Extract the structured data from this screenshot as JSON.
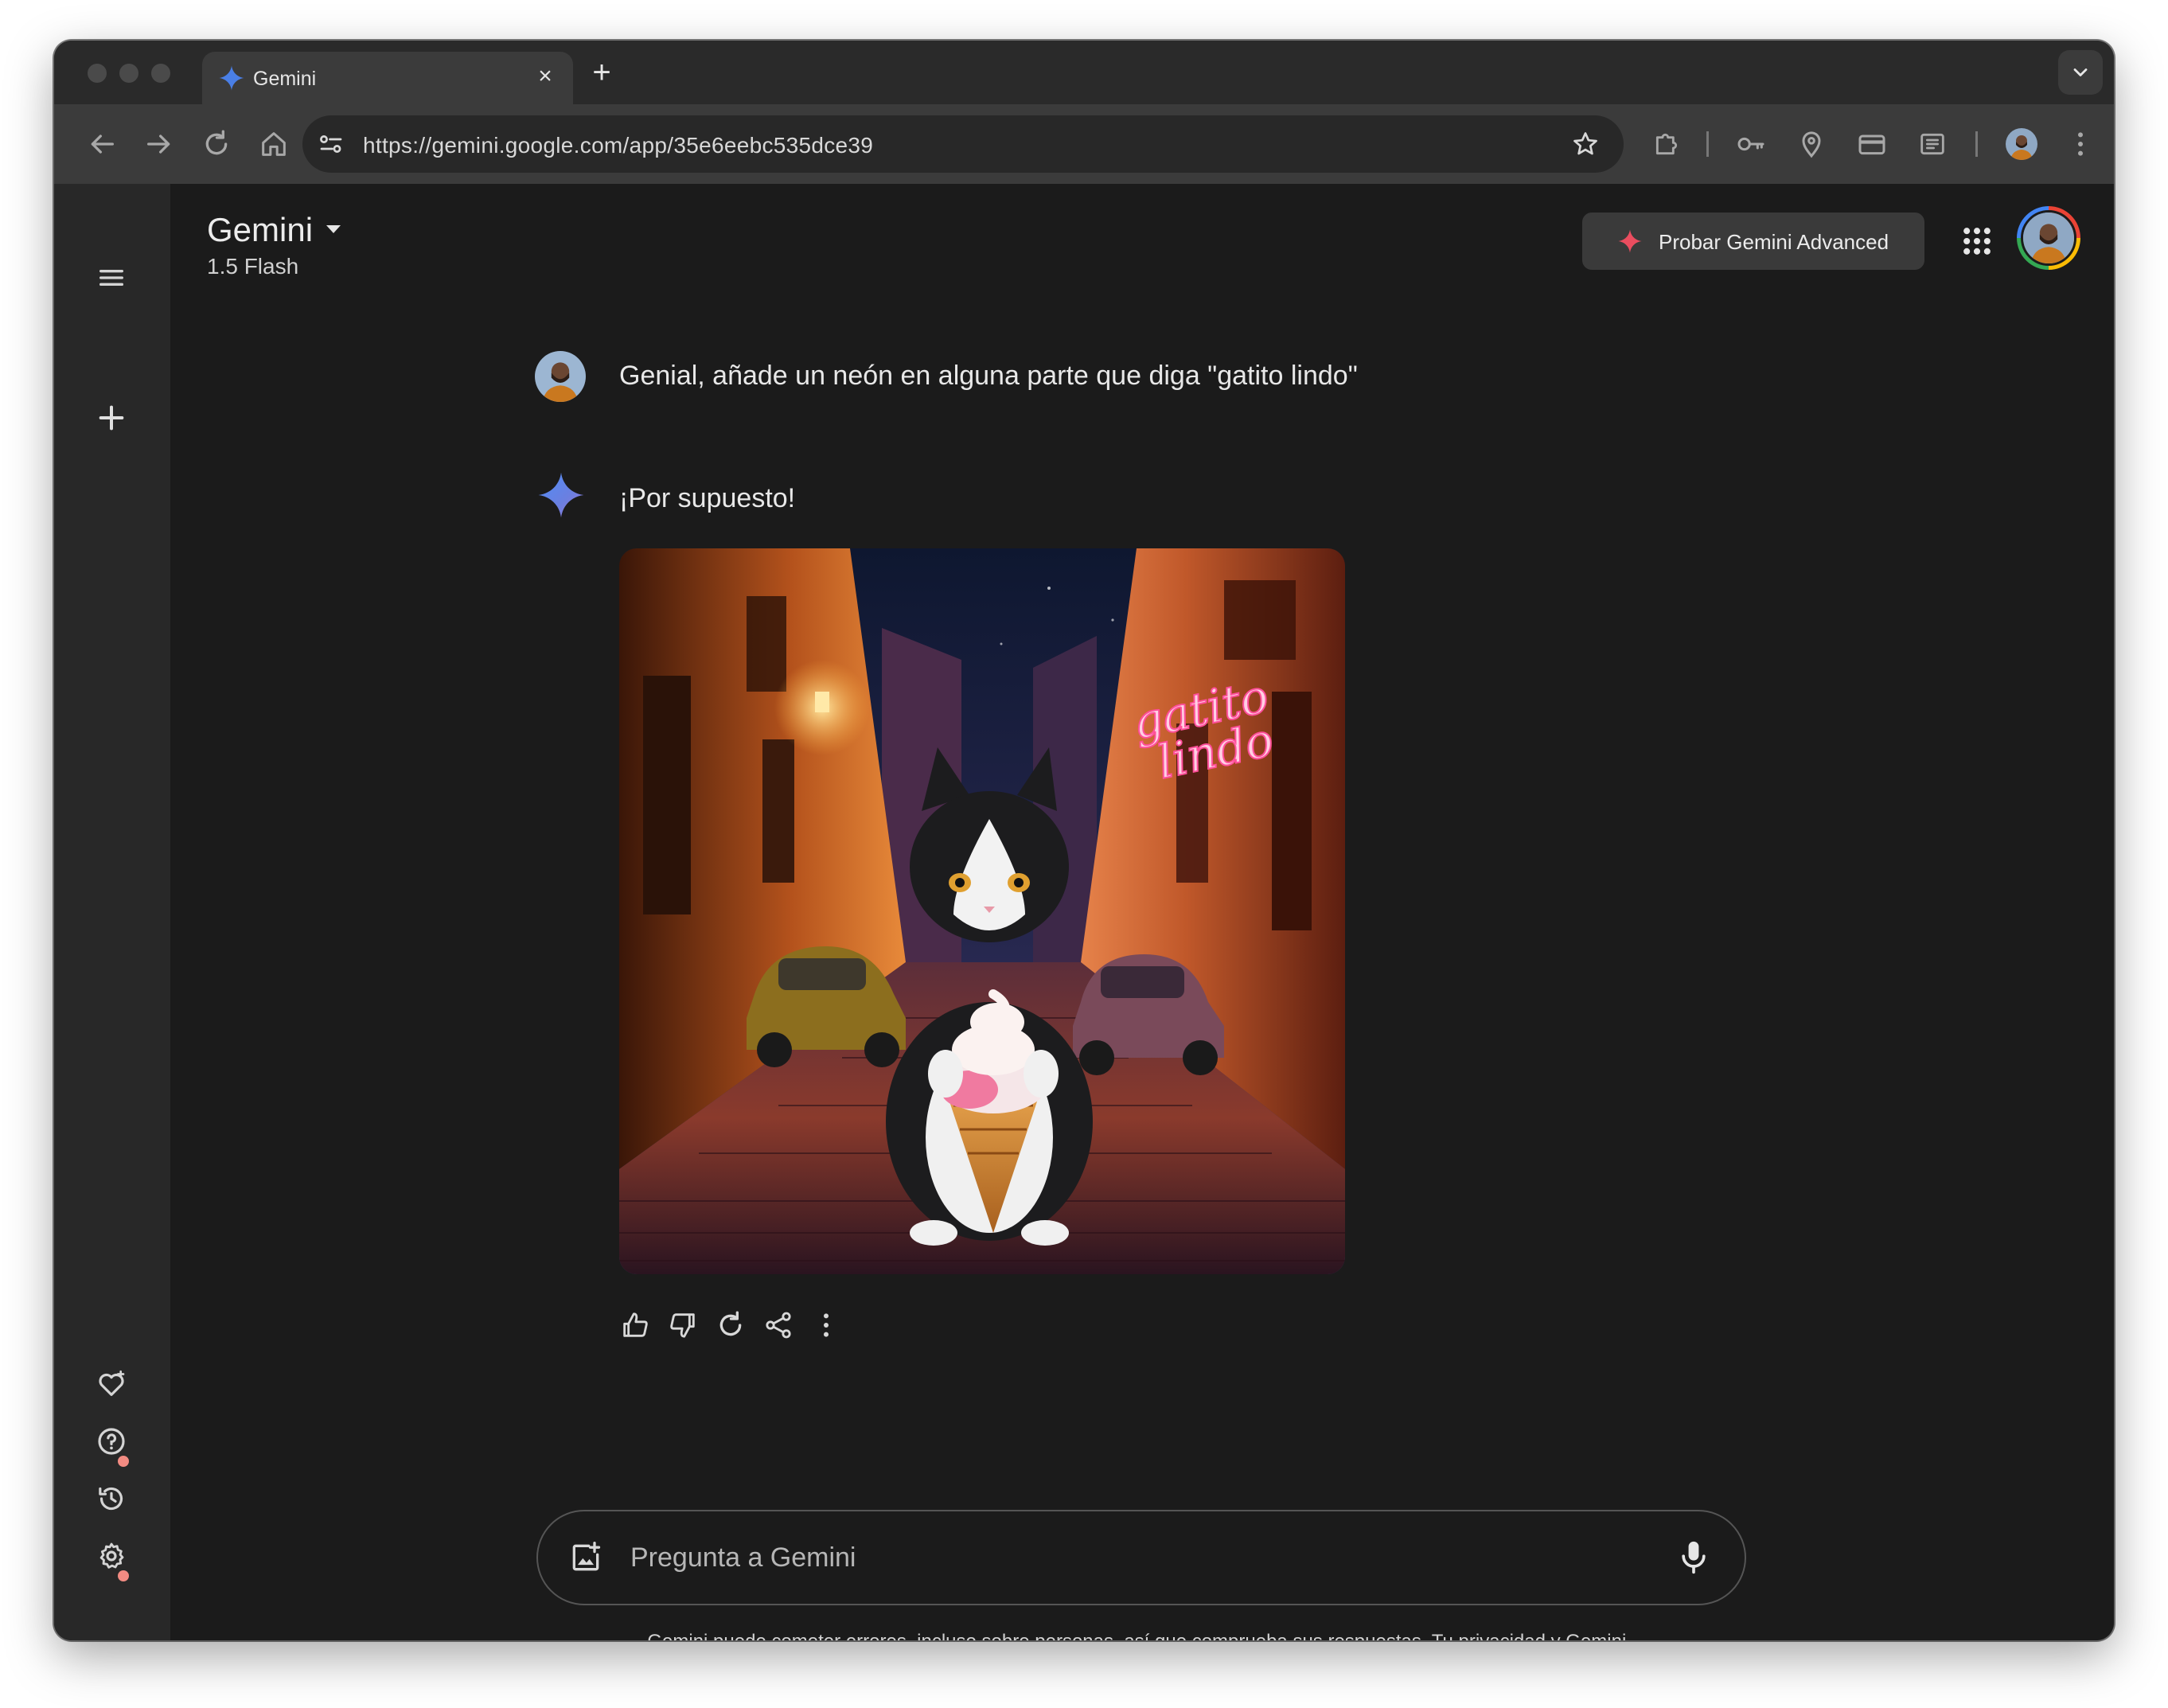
{
  "browser": {
    "tab": {
      "title": "Gemini",
      "close_glyph": "×"
    },
    "new_tab_glyph": "+",
    "url": "https://gemini.google.com/app/35e6eebc535dce39"
  },
  "header": {
    "app_name": "Gemini",
    "model": "1.5 Flash",
    "advanced_button": "Probar Gemini Advanced"
  },
  "chat": {
    "user_message": "Genial, añade un neón en alguna parte que diga \"gatito lindo\"",
    "reply_text": "¡Por supuesto!",
    "image_neon_line1": "gatito",
    "image_neon_line2": "lindo"
  },
  "prompt": {
    "placeholder": "Pregunta a Gemini"
  },
  "footer": {
    "disclaimer": "Gemini puede cometer errores, incluso sobre personas, así que comprueba sus respuestas. ",
    "link": "Tu privacidad y Gemini ",
    "end": "."
  },
  "colors": {
    "accent_blue": "#4285f4",
    "accent_red": "#ea4335",
    "neon_pink": "#ff5fa2"
  }
}
